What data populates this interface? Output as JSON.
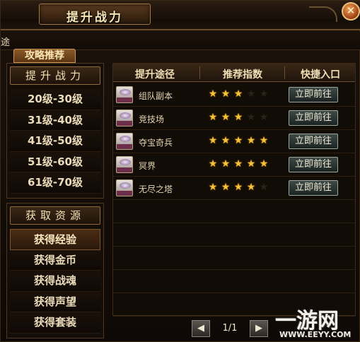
{
  "window": {
    "title": "提升战力"
  },
  "subbar": {
    "edge_text": "途",
    "strategy_tab": "攻略推荐"
  },
  "left_top": {
    "header": "提升战力",
    "items": [
      "20级-30级",
      "31级-40级",
      "41级-50级",
      "51级-60级",
      "61级-70级"
    ]
  },
  "left_bottom": {
    "header": "获取资源",
    "items": [
      "获得经验",
      "获得金币",
      "获得战魂",
      "获得声望",
      "获得套装"
    ],
    "active_index": 0
  },
  "table": {
    "headers": [
      "提升途径",
      "推荐指数",
      "快捷入口"
    ],
    "rows": [
      {
        "name": "组队副本",
        "stars": 3,
        "action": "立即前往"
      },
      {
        "name": "竞技场",
        "stars": 3,
        "action": "立即前往"
      },
      {
        "name": "夺宝奇兵",
        "stars": 5,
        "action": "立即前往"
      },
      {
        "name": "冥界",
        "stars": 5,
        "action": "立即前往"
      },
      {
        "name": "无尽之塔",
        "stars": 4,
        "action": "立即前往"
      }
    ],
    "max_stars": 5
  },
  "pager": {
    "prev": "◀",
    "page": "1/1",
    "next": "▶"
  },
  "watermark": {
    "logo": "一游网",
    "url": "WWW.EEYY.COM"
  },
  "colors": {
    "star_on": "#f5c23a",
    "star_off": "#2c2219",
    "accent": "#a07a45"
  },
  "icons": {
    "close": "close-icon",
    "row": "item-icon"
  }
}
